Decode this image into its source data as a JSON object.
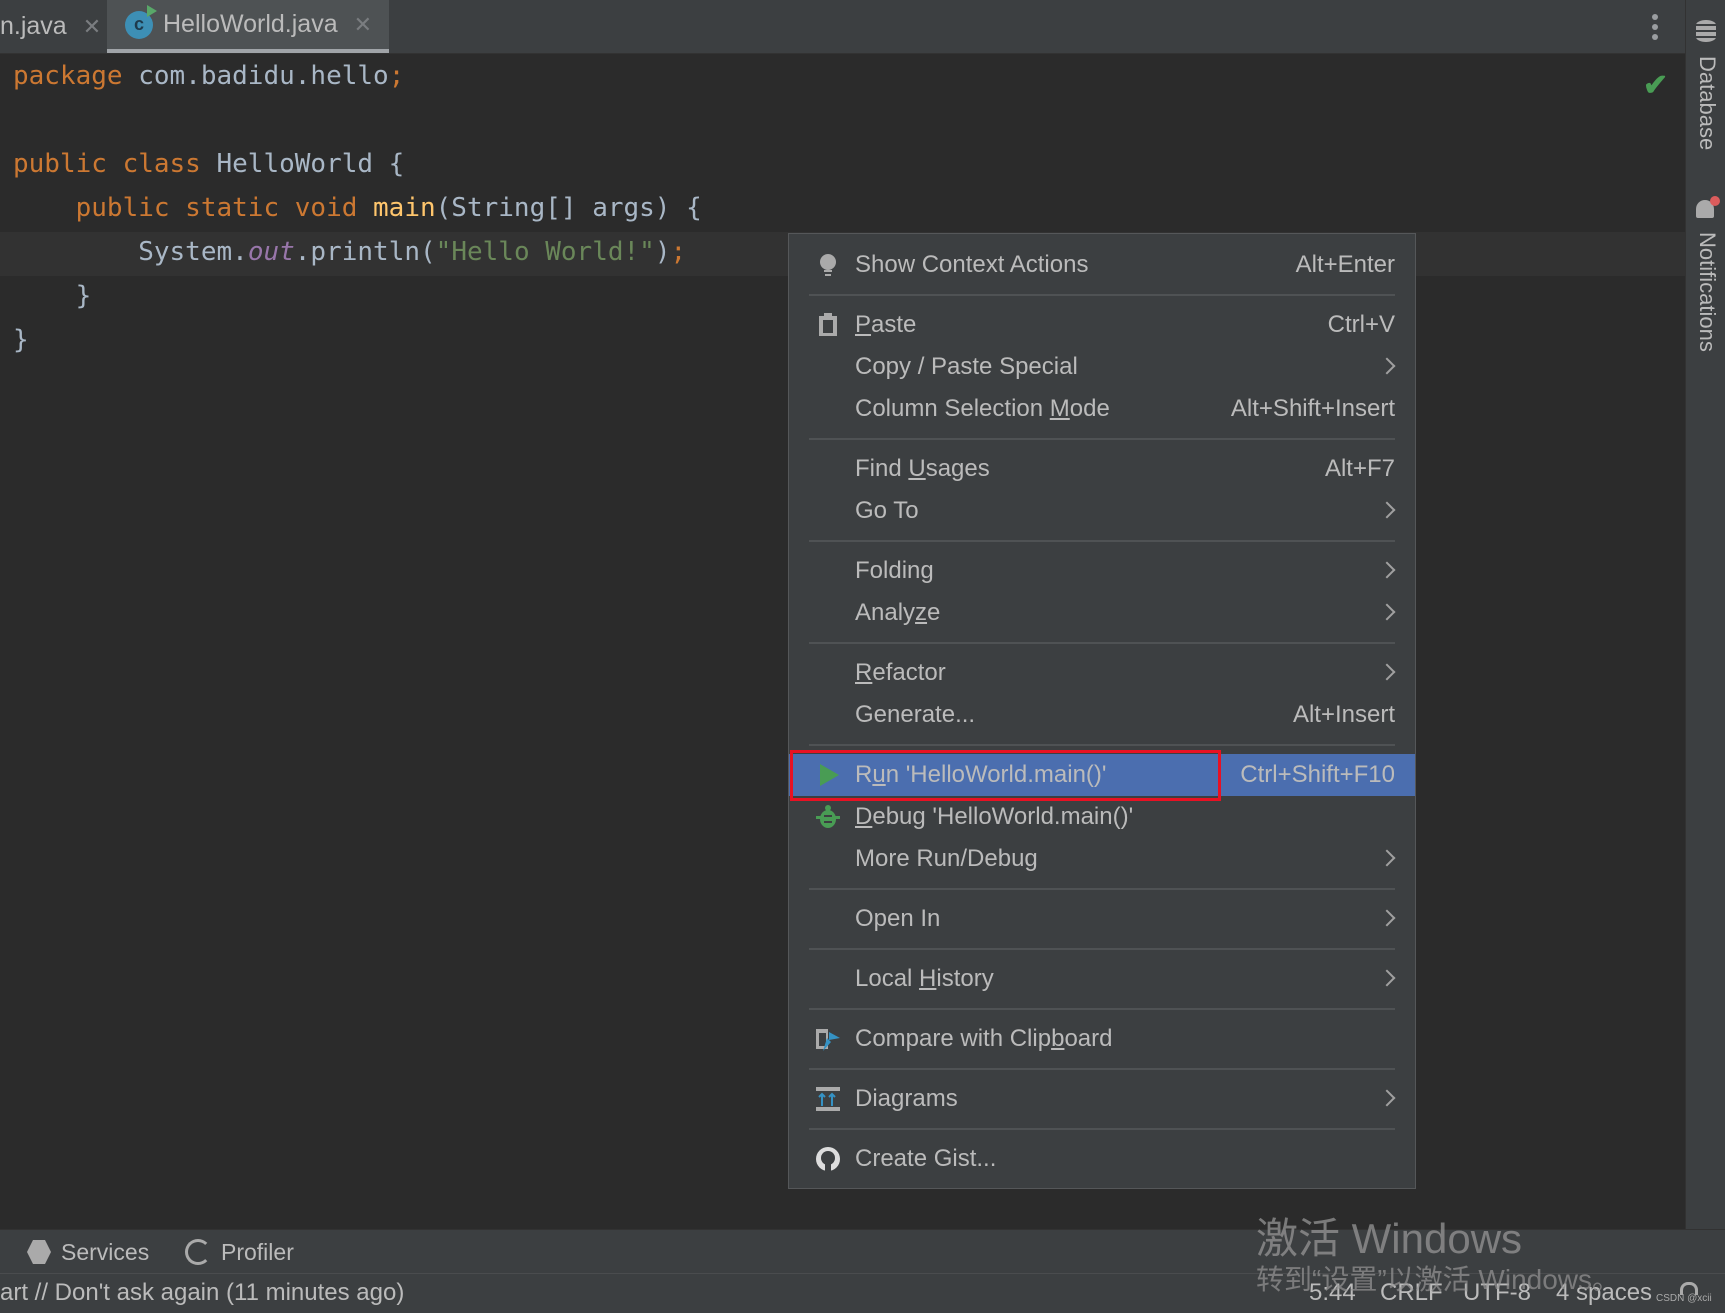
{
  "tabs": [
    {
      "label": "n.java",
      "active": false
    },
    {
      "label": "HelloWorld.java",
      "active": true
    }
  ],
  "code": [
    [
      [
        "package",
        "kw"
      ],
      [
        " com.badidu.hello",
        "plain"
      ],
      [
        ";",
        "kw"
      ]
    ],
    [],
    [
      [
        "public class ",
        "kw"
      ],
      [
        "HelloWorld {",
        "plain"
      ]
    ],
    [
      [
        "    public static void ",
        "kw"
      ],
      [
        "main",
        "fn"
      ],
      [
        "(String[] args) {",
        "plain"
      ]
    ],
    [
      [
        "        System.",
        "plain"
      ],
      [
        "out",
        "field"
      ],
      [
        ".println(",
        "plain"
      ],
      [
        "\"Hello World!\"",
        "str"
      ],
      [
        ")",
        "plain"
      ],
      [
        ";",
        "kw"
      ]
    ],
    [
      [
        "    }",
        "plain"
      ]
    ],
    [
      [
        "}",
        "plain"
      ]
    ]
  ],
  "right_stripe": {
    "database": "Database",
    "notifications": "Notifications"
  },
  "menu": [
    {
      "label": "Show Context Actions",
      "shortcut": "Alt+Enter",
      "icon": "lightbulb-icon"
    },
    {
      "sep": true
    },
    {
      "label": "Paste",
      "shortcut": "Ctrl+V",
      "icon": "clipboard-icon",
      "mn": 0
    },
    {
      "label": "Copy / Paste Special",
      "submenu": true
    },
    {
      "label": "Column Selection Mode",
      "shortcut": "Alt+Shift+Insert",
      "mn": 17
    },
    {
      "sep": true
    },
    {
      "label": "Find Usages",
      "shortcut": "Alt+F7",
      "mn": 5
    },
    {
      "label": "Go To",
      "submenu": true
    },
    {
      "sep": true
    },
    {
      "label": "Folding",
      "submenu": true
    },
    {
      "label": "Analyze",
      "submenu": true,
      "mn": 5
    },
    {
      "sep": true
    },
    {
      "label": "Refactor",
      "submenu": true,
      "mn": 0
    },
    {
      "label": "Generate...",
      "shortcut": "Alt+Insert"
    },
    {
      "sep": true
    },
    {
      "label": "Run 'HelloWorld.main()'",
      "shortcut": "Ctrl+Shift+F10",
      "icon": "run-icon",
      "mn": 1,
      "selected": true
    },
    {
      "label": "Debug 'HelloWorld.main()'",
      "icon": "debug-icon",
      "mn": 0
    },
    {
      "label": "More Run/Debug",
      "submenu": true
    },
    {
      "sep": true
    },
    {
      "label": "Open In",
      "submenu": true
    },
    {
      "sep": true
    },
    {
      "label": "Local History",
      "submenu": true,
      "mn": 6
    },
    {
      "sep": true
    },
    {
      "label": "Compare with Clipboard",
      "icon": "compare-clipboard-icon",
      "mn": 17
    },
    {
      "sep": true
    },
    {
      "label": "Diagrams",
      "submenu": true,
      "icon": "diagrams-icon"
    },
    {
      "sep": true
    },
    {
      "label": "Create Gist...",
      "icon": "github-icon"
    }
  ],
  "toolwindows": [
    {
      "label": "Services",
      "icon": "services-icon"
    },
    {
      "label": "Profiler",
      "icon": "profiler-icon"
    }
  ],
  "status": {
    "message": "art // Don't ask again (11 minutes ago)",
    "position": "5:44",
    "line_sep": "CRLF",
    "encoding": "UTF-8",
    "indent": "4 spaces"
  },
  "watermark": {
    "line1": "激活 Windows",
    "line2": "转到“设置”以激活 Windows。",
    "credit": "CSDN @xcii"
  },
  "colors": {
    "accent": "#4b6eaf",
    "highlight_box": "#e81123",
    "run_green": "#499c54"
  }
}
